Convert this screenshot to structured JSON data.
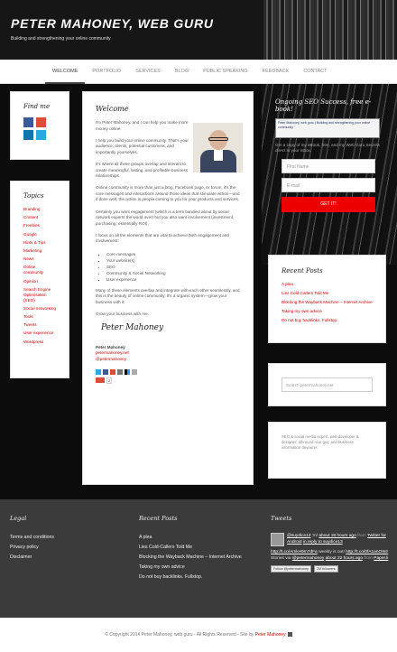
{
  "header": {
    "title": "PETER MAHONEY, WEB GURU",
    "tagline": "Building and strengthening your online community"
  },
  "nav": [
    "WELCOME",
    "PORTFOLIO",
    "SERVICES",
    "BLOG",
    "PUBLIC SPEAKING",
    "FEEDBACK",
    "CONTACT"
  ],
  "findme": {
    "title": "Find me",
    "icons": [
      "facebook-icon",
      "google-plus-icon",
      "linkedin-icon",
      "twitter-icon"
    ]
  },
  "topics": {
    "title": "Topics",
    "items": [
      "Branding",
      "Content",
      "Freebies",
      "Google",
      "Hints & Tips",
      "Marketing",
      "News",
      "Online community",
      "Opinion",
      "Search Engine Optimisation (SEO)",
      "Social networking",
      "Tools",
      "Tweets",
      "User experience",
      "Wordpress"
    ]
  },
  "main": {
    "title": "Welcome",
    "p1": "I'm Peter Mahoney, and I can help you make more money online.",
    "p2": "I help you build your online community. That's your audience; clients, potential customers, and importantly yourselves.",
    "p3": "It's where all these groups overlap and interact to create meaningful, lasting, and profitable business relationships.",
    "p4": "Online community is more than just a blog, Facebook page, or forum, it's the core messages and interactions around those ideas that stimulate action—and if done well, the action is people coming to you for your products and services.",
    "p5": "Certainly you want engagement (which is a term bandied about by social network experts the world over) but you also want involvement (investment, purchasing; essentially ROI).",
    "p6": "I focus on all the elements that are vital to achieve both engagement and involvement:",
    "list": [
      "Core messages",
      "Your website(s)",
      "SEO",
      "Community & Social Networking",
      "User experience"
    ],
    "p7": "Many of these elements overlap and integrate with each other seamlessly, and this is the beauty of online community. It's a organic system—grow your business with it.",
    "p8": "Grow your business with me.",
    "signature": "Peter Mahoney",
    "name": "Peter Mahoney",
    "email": "petermahoney.net",
    "twitter": "@petermahoney",
    "share_count": "2"
  },
  "ebook": {
    "title": "Ongoing SEO Success, free e-book!",
    "preview": "Peter Mahoney, web guru | Building and strengthening your online community",
    "desc": "Get a copy of my eBook, free, and my Web Guru Secrets direct to your inbox.",
    "first_name_placeholder": "First Name",
    "email_placeholder": "E-mail",
    "button": "GET IT!"
  },
  "recent_sidebar": {
    "title": "Recent Posts",
    "items": [
      "A plea",
      "Lies Cold-Callers Told Me",
      "Blocking the Wayback Machine – Internet Archive",
      "Taking my own advice",
      "Do not buy backlinks. Fullstop."
    ]
  },
  "search": {
    "placeholder": "Search petermahoney.net"
  },
  "about": {
    "text": "SEO & social media expert, web developer & designer, all-round nice guy, and business information devourer."
  },
  "footer": {
    "legal_title": "Legal",
    "legal": [
      "Terms and conditions",
      "Privacy policy",
      "Disclaimer"
    ],
    "recent_title": "Recent Posts",
    "recent": [
      "A plea",
      "Lies Cold-Callers Told Me",
      "Blocking the Wayback Machine – Internet Archive",
      "Taking my own advice",
      "Do not buy backlinks. Fullstop."
    ],
    "tweets_title": "Tweets",
    "tweet1": {
      "user": "@suydice13",
      "text": "'m/",
      "meta": "about 18 hours ago",
      "from": "from",
      "via": "Twitter for Android",
      "reply": "in reply to suydice13"
    },
    "tweet2": {
      "link": "http://t.co/AmkH9m7dFa",
      "text": "weekly is out!",
      "link2": "http://t.co/0fA1anOWz",
      "text2": "Stories via",
      "mention": "@petermahoney",
      "meta": "about 22 hours ago",
      "from": "from",
      "via": "Paper.li"
    },
    "follow_btn": "Follow @petermahoney",
    "followers": "2M followers"
  },
  "copyright": {
    "text": "© Copyright 2014 Peter Mahoney, web guru - All Rights Reserved - Site by",
    "author": "Peter Mahoney"
  },
  "colors": {
    "accent": "#cc0000",
    "button": "#ee0000",
    "footer": "#3b3b3b"
  }
}
